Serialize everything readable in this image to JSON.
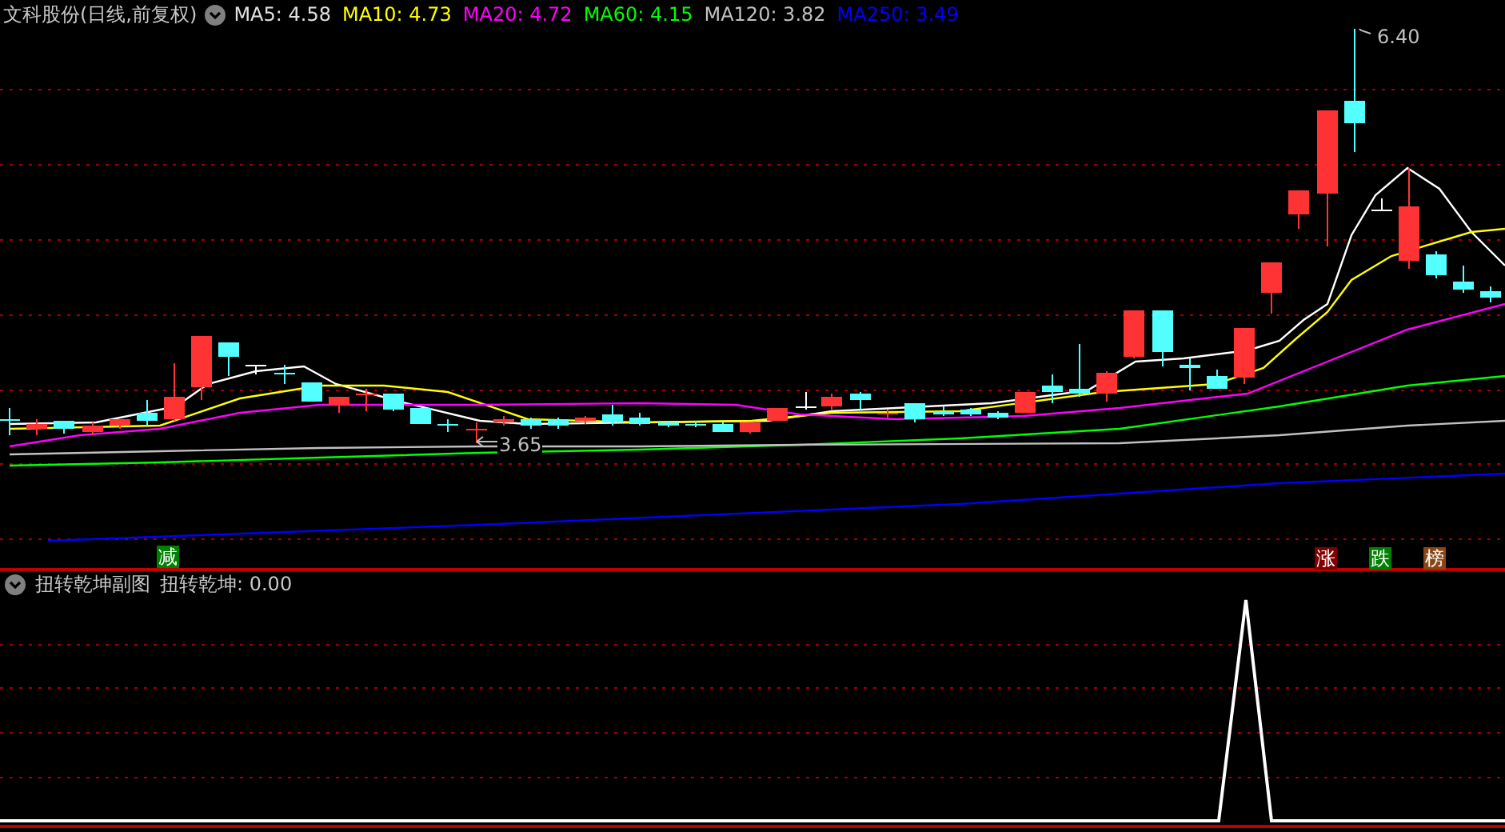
{
  "header": {
    "title": "文科股份(日线,前复权)",
    "indicators": [
      {
        "label": "MA5: 4.58",
        "color": "#e0e0e0"
      },
      {
        "label": "MA10: 4.73",
        "color": "#ffff00"
      },
      {
        "label": "MA20: 4.72",
        "color": "#ff00ff"
      },
      {
        "label": "MA60: 4.15",
        "color": "#00ff00"
      },
      {
        "label": "MA120: 3.82",
        "color": "#c0c0c0"
      },
      {
        "label": "MA250: 3.49",
        "color": "#0000ff"
      }
    ]
  },
  "main_chart": {
    "high_label": "6.40",
    "low_label": "3.65",
    "markers": [
      {
        "label": "减",
        "color": "#008000"
      },
      {
        "label": "涨",
        "color": "#800000"
      },
      {
        "label": "跌",
        "color": "#008000"
      },
      {
        "label": "榜",
        "color": "#8b4513"
      }
    ]
  },
  "sub_panel": {
    "title": "扭转乾坤副图",
    "reading": "扭转乾坤: 0.00"
  }
}
